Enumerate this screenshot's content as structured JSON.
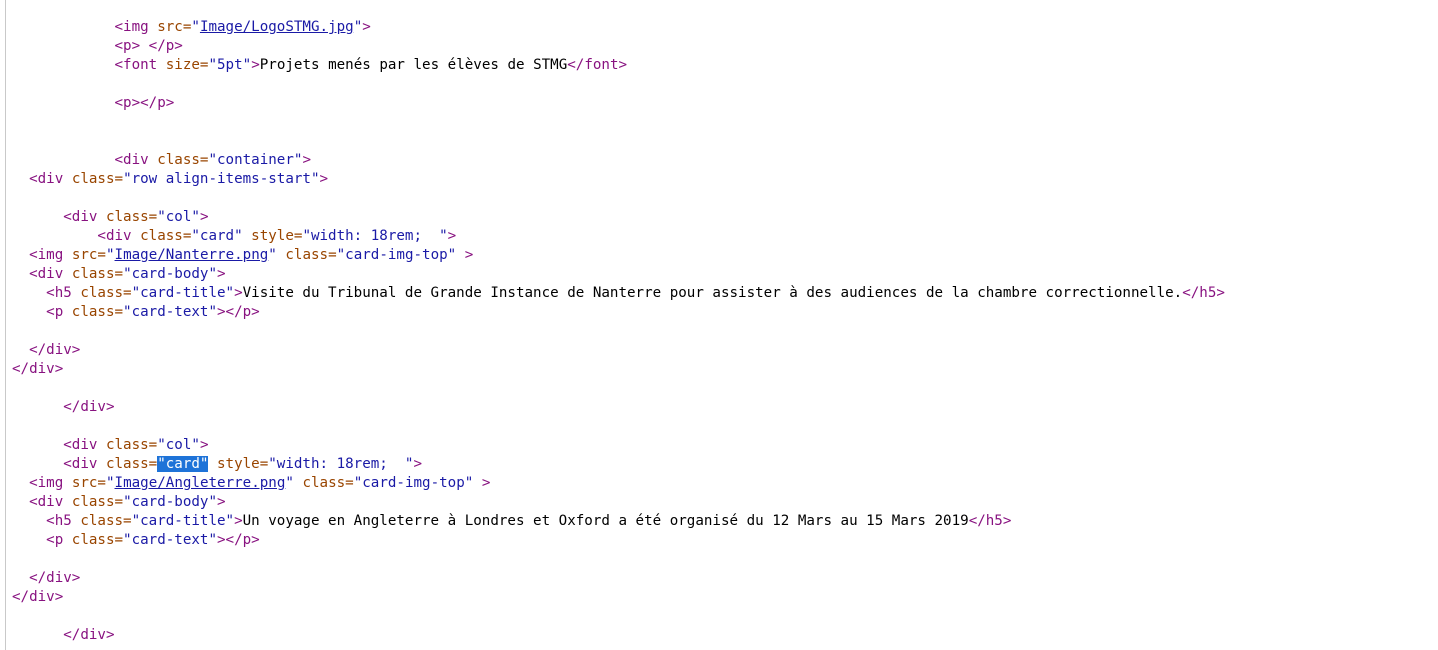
{
  "source_lines": [
    [
      {
        "t": "            "
      },
      {
        "t": "<img ",
        "k": "tag"
      },
      {
        "t": "src=",
        "k": "attr"
      },
      {
        "t": "\"",
        "k": "value"
      },
      {
        "t": "Image/LogoSTMG.jpg",
        "k": "link"
      },
      {
        "t": "\"",
        "k": "value"
      },
      {
        "t": ">",
        "k": "tag"
      }
    ],
    [
      {
        "t": "            "
      },
      {
        "t": "<p> </p>",
        "k": "tag"
      }
    ],
    [
      {
        "t": "            "
      },
      {
        "t": "<font ",
        "k": "tag"
      },
      {
        "t": "size=",
        "k": "attr"
      },
      {
        "t": "\"5pt\"",
        "k": "value"
      },
      {
        "t": ">",
        "k": "tag"
      },
      {
        "t": "Projets menés par les élèves de STMG",
        "k": "text"
      },
      {
        "t": "</font>",
        "k": "tag"
      }
    ],
    [],
    [
      {
        "t": "            "
      },
      {
        "t": "<p></p>",
        "k": "tag"
      }
    ],
    [],
    [],
    [
      {
        "t": "            "
      },
      {
        "t": "<div ",
        "k": "tag"
      },
      {
        "t": "class=",
        "k": "attr"
      },
      {
        "t": "\"container\"",
        "k": "value"
      },
      {
        "t": ">",
        "k": "tag"
      }
    ],
    [
      {
        "t": "  "
      },
      {
        "t": "<div ",
        "k": "tag"
      },
      {
        "t": "class=",
        "k": "attr"
      },
      {
        "t": "\"row align-items-start\"",
        "k": "value"
      },
      {
        "t": ">",
        "k": "tag"
      }
    ],
    [],
    [
      {
        "t": "      "
      },
      {
        "t": "<div ",
        "k": "tag"
      },
      {
        "t": "class=",
        "k": "attr"
      },
      {
        "t": "\"col\"",
        "k": "value"
      },
      {
        "t": ">",
        "k": "tag"
      }
    ],
    [
      {
        "t": "          "
      },
      {
        "t": "<div ",
        "k": "tag"
      },
      {
        "t": "class=",
        "k": "attr"
      },
      {
        "t": "\"card\"",
        "k": "value"
      },
      {
        "t": " style=",
        "k": "attr"
      },
      {
        "t": "\"width: 18rem;  \"",
        "k": "value"
      },
      {
        "t": ">",
        "k": "tag"
      }
    ],
    [
      {
        "t": "  "
      },
      {
        "t": "<img ",
        "k": "tag"
      },
      {
        "t": "src=",
        "k": "attr"
      },
      {
        "t": "\"",
        "k": "value"
      },
      {
        "t": "Image/Nanterre.png",
        "k": "link"
      },
      {
        "t": "\"",
        "k": "value"
      },
      {
        "t": " class=",
        "k": "attr"
      },
      {
        "t": "\"card-img-top\"",
        "k": "value"
      },
      {
        "t": " >",
        "k": "tag"
      }
    ],
    [
      {
        "t": "  "
      },
      {
        "t": "<div ",
        "k": "tag"
      },
      {
        "t": "class=",
        "k": "attr"
      },
      {
        "t": "\"card-body\"",
        "k": "value"
      },
      {
        "t": ">",
        "k": "tag"
      }
    ],
    [
      {
        "t": "    "
      },
      {
        "t": "<h5 ",
        "k": "tag"
      },
      {
        "t": "class=",
        "k": "attr"
      },
      {
        "t": "\"card-title\"",
        "k": "value"
      },
      {
        "t": ">",
        "k": "tag"
      },
      {
        "t": "Visite du Tribunal de Grande Instance de Nanterre pour assister à des audiences de la chambre correctionnelle.",
        "k": "text"
      },
      {
        "t": "</h5>",
        "k": "tag"
      }
    ],
    [
      {
        "t": "    "
      },
      {
        "t": "<p ",
        "k": "tag"
      },
      {
        "t": "class=",
        "k": "attr"
      },
      {
        "t": "\"card-text\"",
        "k": "value"
      },
      {
        "t": "></p>",
        "k": "tag"
      }
    ],
    [],
    [
      {
        "t": "  "
      },
      {
        "t": "</div>",
        "k": "tag"
      }
    ],
    [
      {
        "t": "</div>",
        "k": "tag"
      }
    ],
    [],
    [
      {
        "t": "      "
      },
      {
        "t": "</div>",
        "k": "tag"
      }
    ],
    [],
    [
      {
        "t": "      "
      },
      {
        "t": "<div ",
        "k": "tag"
      },
      {
        "t": "class=",
        "k": "attr"
      },
      {
        "t": "\"col\"",
        "k": "value"
      },
      {
        "t": ">",
        "k": "tag"
      }
    ],
    [
      {
        "t": "      "
      },
      {
        "t": "<div ",
        "k": "tag"
      },
      {
        "t": "class=",
        "k": "attr"
      },
      {
        "t": "\"card\"",
        "k": "sel"
      },
      {
        "t": " style=",
        "k": "attr"
      },
      {
        "t": "\"width: 18rem;  \"",
        "k": "value"
      },
      {
        "t": ">",
        "k": "tag"
      }
    ],
    [
      {
        "t": "  "
      },
      {
        "t": "<img ",
        "k": "tag"
      },
      {
        "t": "src=",
        "k": "attr"
      },
      {
        "t": "\"",
        "k": "value"
      },
      {
        "t": "Image/Angleterre.png",
        "k": "link"
      },
      {
        "t": "\"",
        "k": "value"
      },
      {
        "t": " class=",
        "k": "attr"
      },
      {
        "t": "\"card-img-top\"",
        "k": "value"
      },
      {
        "t": " >",
        "k": "tag"
      }
    ],
    [
      {
        "t": "  "
      },
      {
        "t": "<div ",
        "k": "tag"
      },
      {
        "t": "class=",
        "k": "attr"
      },
      {
        "t": "\"card-body\"",
        "k": "value"
      },
      {
        "t": ">",
        "k": "tag"
      }
    ],
    [
      {
        "t": "    "
      },
      {
        "t": "<h5 ",
        "k": "tag"
      },
      {
        "t": "class=",
        "k": "attr"
      },
      {
        "t": "\"card-title\"",
        "k": "value"
      },
      {
        "t": ">",
        "k": "tag"
      },
      {
        "t": "Un voyage en Angleterre à Londres et Oxford a été organisé du 12 Mars au 15 Mars 2019",
        "k": "text"
      },
      {
        "t": "</h5>",
        "k": "tag"
      }
    ],
    [
      {
        "t": "    "
      },
      {
        "t": "<p ",
        "k": "tag"
      },
      {
        "t": "class=",
        "k": "attr"
      },
      {
        "t": "\"card-text\"",
        "k": "value"
      },
      {
        "t": "></p>",
        "k": "tag"
      }
    ],
    [],
    [
      {
        "t": "  "
      },
      {
        "t": "</div>",
        "k": "tag"
      }
    ],
    [
      {
        "t": "</div>",
        "k": "tag"
      }
    ],
    [],
    [
      {
        "t": "      "
      },
      {
        "t": "</div>",
        "k": "tag"
      }
    ]
  ],
  "colors": {
    "tag": "#881280",
    "attribute": "#994500",
    "value": "#1a1aa6",
    "selection": "#1e73d8"
  }
}
